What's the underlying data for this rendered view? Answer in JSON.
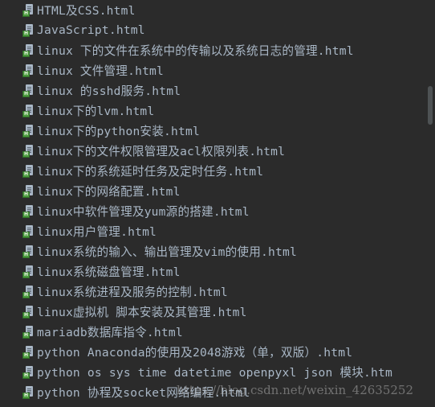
{
  "files": [
    {
      "name": "HTML及CSS.html",
      "icon": "html-file-icon"
    },
    {
      "name": "JavaScript.html",
      "icon": "html-file-icon"
    },
    {
      "name": "linux 下的文件在系统中的传输以及系统日志的管理.html",
      "icon": "html-file-icon"
    },
    {
      "name": "linux  文件管理.html",
      "icon": "html-file-icon"
    },
    {
      "name": "linux  的sshd服务.html",
      "icon": "html-file-icon"
    },
    {
      "name": "linux下的lvm.html",
      "icon": "html-file-icon"
    },
    {
      "name": "linux下的python安装.html",
      "icon": "html-file-icon"
    },
    {
      "name": "linux下的文件权限管理及acl权限列表.html",
      "icon": "html-file-icon"
    },
    {
      "name": "linux下的系统延时任务及定时任务.html",
      "icon": "html-file-icon"
    },
    {
      "name": "linux下的网络配置.html",
      "icon": "html-file-icon"
    },
    {
      "name": "linux中软件管理及yum源的搭建.html",
      "icon": "html-file-icon"
    },
    {
      "name": "linux用户管理.html",
      "icon": "html-file-icon"
    },
    {
      "name": "linux系统的输入、输出管理及vim的使用.html",
      "icon": "html-file-icon"
    },
    {
      "name": "linux系统磁盘管理.html",
      "icon": "html-file-icon"
    },
    {
      "name": "linux系统进程及服务的控制.html",
      "icon": "html-file-icon"
    },
    {
      "name": "linux虚拟机 脚本安装及其管理.html",
      "icon": "html-file-icon"
    },
    {
      "name": "mariadb数据库指令.html",
      "icon": "html-file-icon"
    },
    {
      "name": "python Anaconda的使用及2048游戏（单，双版）.html",
      "icon": "html-file-icon"
    },
    {
      "name": "python os sys  time datetime openpyxl json 模块.htm",
      "icon": "html-file-icon"
    },
    {
      "name": "python 协程及socket网络编程.html",
      "icon": "html-file-icon"
    }
  ],
  "icon_badge": "H",
  "watermark": "https://blog.csdn.net/weixin_42635252",
  "colors": {
    "background": "#2b2b2b",
    "text": "#a9b7c6",
    "badge": "#4b9a3e",
    "scrollbar_thumb": "#4e5254"
  }
}
